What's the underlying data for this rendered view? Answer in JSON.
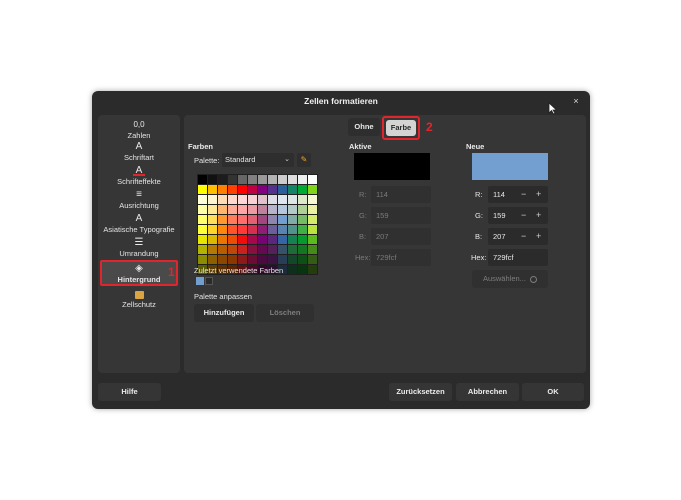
{
  "dialog": {
    "title": "Zellen formatieren",
    "close_glyph": "×"
  },
  "sidebar": {
    "items": [
      {
        "label": "Zahlen",
        "icon": "0,0"
      },
      {
        "label": "Schriftart",
        "icon": "A"
      },
      {
        "label": "Schrifteffekte",
        "icon": "A"
      },
      {
        "label": "Ausrichtung",
        "icon": "≡"
      },
      {
        "label": "Asiatische Typografie",
        "icon": "A"
      },
      {
        "label": "Umrandung",
        "icon": "☰"
      },
      {
        "label": "Hintergrund",
        "icon": "◈"
      },
      {
        "label": "Zellschutz",
        "icon": "🔒"
      }
    ],
    "selected_index": 6,
    "annotation": "1"
  },
  "tabs": {
    "ohne": "Ohne",
    "farbe": "Farbe",
    "annotation": "2"
  },
  "farben": {
    "title": "Farben",
    "palette_label": "Palette:",
    "palette_value": "Standard",
    "recent_label": "Zuletzt verwendete Farben",
    "recent_colors": [
      "#729fcf",
      "#2b2b2b"
    ],
    "palette_adjust_label": "Palette anpassen",
    "add_button": "Hinzufügen",
    "delete_button": "Löschen",
    "grid_colors": [
      [
        "#000000",
        "#111111",
        "#1c1c1c",
        "#333333",
        "#666666",
        "#808080",
        "#999999",
        "#b2b2b2",
        "#cccccc",
        "#dddddd",
        "#eeeeee",
        "#ffffff"
      ],
      [
        "#ffff00",
        "#ffbf00",
        "#ff8000",
        "#ff4000",
        "#ff0000",
        "#bf0041",
        "#800080",
        "#55308d",
        "#2a6099",
        "#158466",
        "#00a933",
        "#81d41a"
      ],
      [
        "#ffffd7",
        "#fff5ce",
        "#ffdbb6",
        "#ffd8ce",
        "#ffd7d7",
        "#f7d1d5",
        "#e0c2cd",
        "#dedce6",
        "#dee6ef",
        "#dee7e5",
        "#dde8cb",
        "#f6f9d4"
      ],
      [
        "#ffffa6",
        "#ffe994",
        "#ffb66c",
        "#ffaa95",
        "#ffa6a6",
        "#ec9ba4",
        "#bf819e",
        "#b7b3ca",
        "#b4c7dc",
        "#b3cac7",
        "#afd095",
        "#e8f2a1"
      ],
      [
        "#ffff6d",
        "#ffde59",
        "#ff972f",
        "#ff7b59",
        "#ff6d6d",
        "#e16173",
        "#a1467e",
        "#8e86ae",
        "#729fcf",
        "#81aca6",
        "#77bc65",
        "#d4ea6b"
      ],
      [
        "#ffff38",
        "#ffd428",
        "#ff860d",
        "#ff5429",
        "#ff3838",
        "#d62e4e",
        "#8d1d75",
        "#6b5e9b",
        "#5983b0",
        "#50938a",
        "#3faf46",
        "#bbe33d"
      ],
      [
        "#e6e600",
        "#dcb900",
        "#ea7500",
        "#ed4c05",
        "#f10d0c",
        "#a7074b",
        "#780373",
        "#5b277d",
        "#3465a4",
        "#168253",
        "#069a2e",
        "#5eb91e"
      ],
      [
        "#b2b200",
        "#b47804",
        "#b85c00",
        "#be480a",
        "#c9211e",
        "#861141",
        "#650953",
        "#55215b",
        "#355269",
        "#1e6a39",
        "#127622",
        "#468a1a"
      ],
      [
        "#8c8c00",
        "#8c6000",
        "#8c4600",
        "#8c3600",
        "#8c1a1a",
        "#6b0d33",
        "#4b0a40",
        "#3c1444",
        "#283e57",
        "#14462a",
        "#0c5016",
        "#345c14"
      ],
      [
        "#5c5c00",
        "#5c3f00",
        "#5c2e00",
        "#5c2400",
        "#5c1111",
        "#470924",
        "#33072b",
        "#28102e",
        "#1c2b3d",
        "#0e2f1c",
        "#08350e",
        "#233d0d"
      ]
    ]
  },
  "aktive": {
    "title": "Aktive",
    "color": "#000000",
    "r_label": "R:",
    "r": "114",
    "g_label": "G:",
    "g": "159",
    "b_label": "B:",
    "b": "207",
    "hex_label": "Hex:",
    "hex": "729fcf"
  },
  "neue": {
    "title": "Neue",
    "color": "#729fcf",
    "r_label": "R:",
    "r": "114",
    "g_label": "G:",
    "g": "159",
    "b_label": "B:",
    "b": "207",
    "hex_label": "Hex:",
    "hex": "729fcf",
    "minus": "−",
    "plus": "+",
    "pick_button": "Auswählen..."
  },
  "footer": {
    "help": "Hilfe",
    "reset": "Zurücksetzen",
    "cancel": "Abbrechen",
    "ok": "OK"
  }
}
